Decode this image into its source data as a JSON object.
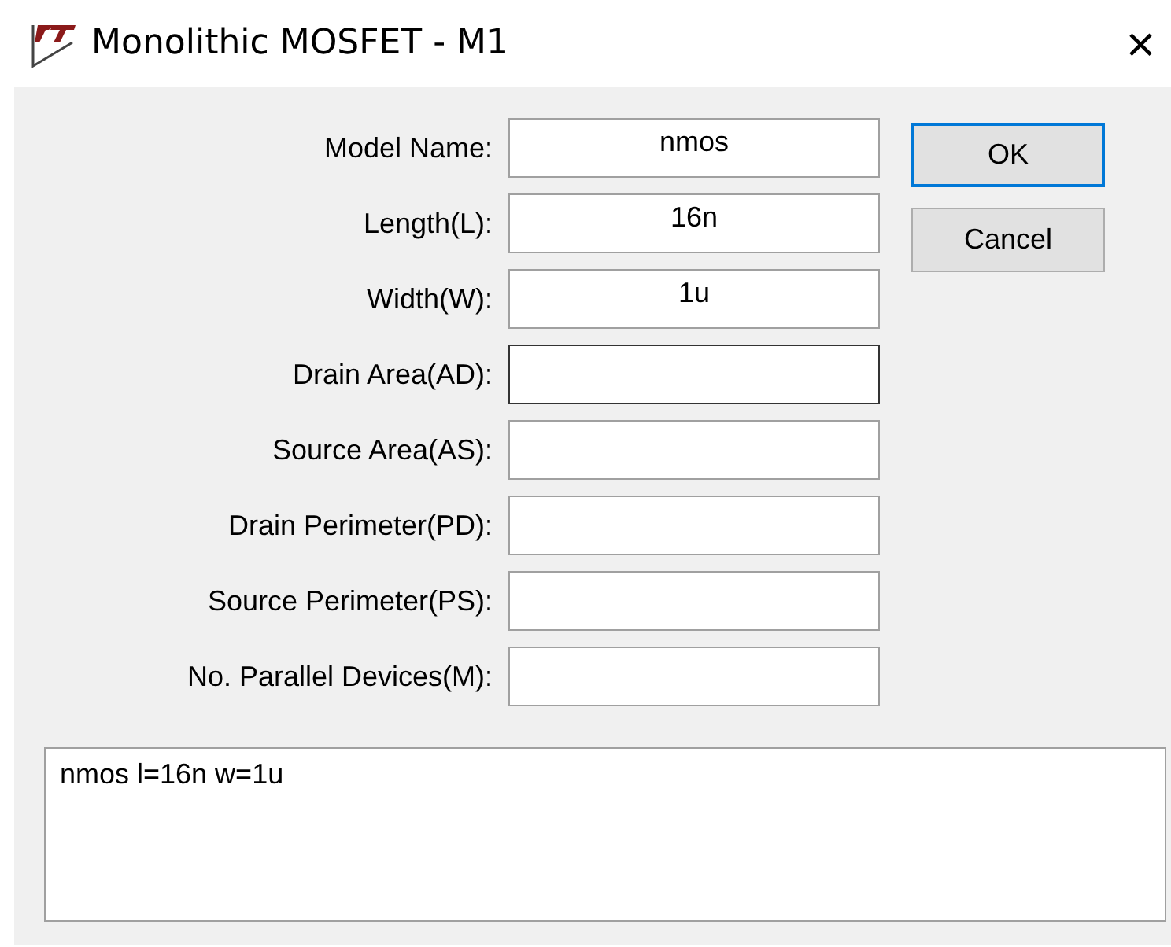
{
  "window": {
    "title": "Monolithic MOSFET - M1",
    "close": "×"
  },
  "fields": [
    {
      "label": "Model Name:",
      "value": "nmos",
      "focused": false
    },
    {
      "label": "Length(L):",
      "value": "16n",
      "focused": false
    },
    {
      "label": "Width(W):",
      "value": "1u",
      "focused": false
    },
    {
      "label": "Drain Area(AD):",
      "focused": true
    },
    {
      "label": "Source Area(AS):",
      "focused": false
    },
    {
      "label": "Drain Perimeter(PD):",
      "focused": false
    },
    {
      "label": "Source Perimeter(PS):",
      "focused": false
    },
    {
      "label": "No. Parallel Devices(M):",
      "focused": false
    }
  ],
  "buttons": [
    {
      "label": "OK",
      "default": true
    },
    {
      "label": "Cancel",
      "default": false
    }
  ],
  "preview": "nmos l=16n w=1u"
}
